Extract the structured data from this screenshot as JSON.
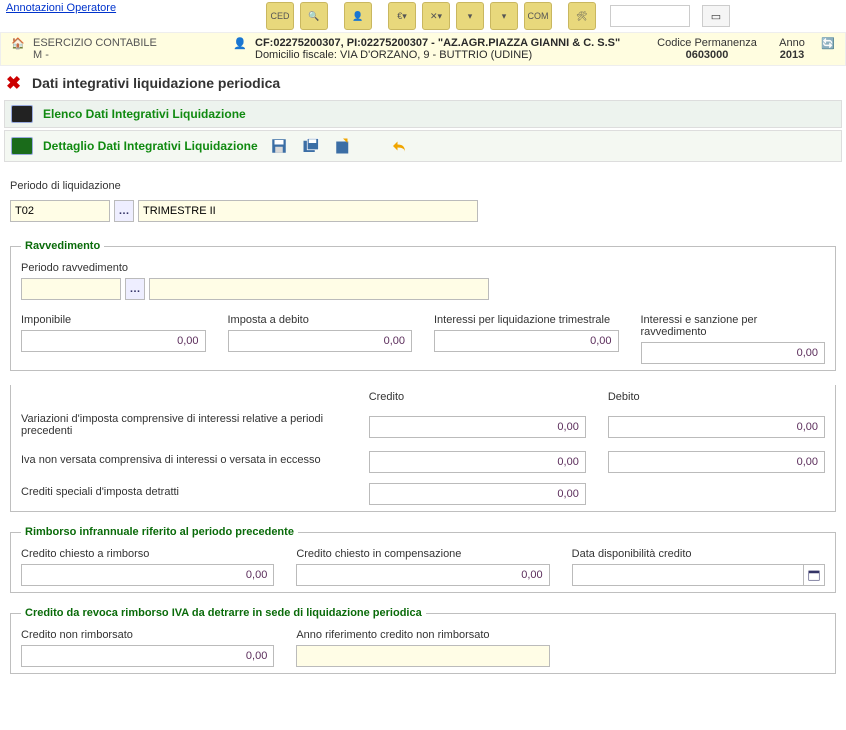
{
  "top": {
    "annotazioni": "Annotazioni Operatore",
    "toolbarIcons": [
      "CED",
      "doc",
      "user",
      "filter1",
      "filter2",
      "filter3",
      "filter4",
      "COM",
      "",
      "build"
    ]
  },
  "header": {
    "esercizio_lbl": "ESERCIZIO CONTABILE",
    "esercizio_val": "M -",
    "cf": "CF:02275200307, PI:02275200307 - \"AZ.AGR.PIAZZA GIANNI & C. S.S\"",
    "domicilio": "Domicilio fiscale: VIA D'ORZANO, 9 - BUTTRIO (UDINE)",
    "codperm_lbl": "Codice Permanenza",
    "codperm_val": "0603000",
    "anno_lbl": "Anno",
    "anno_val": "2013"
  },
  "title": "Dati integrativi liquidazione periodica",
  "tabs": {
    "elenco": "Elenco Dati Integrativi Liquidazione",
    "dettaglio": "Dettaglio Dati Integrativi Liquidazione"
  },
  "periodo": {
    "lbl": "Periodo di liquidazione",
    "code": "T02",
    "desc": "TRIMESTRE II"
  },
  "ravv": {
    "legend": "Ravvedimento",
    "per_lbl": "Periodo ravvedimento",
    "per_code": "",
    "per_desc": "",
    "imponibile_lbl": "Imponibile",
    "imposta_lbl": "Imposta a debito",
    "interessi_lbl": "Interessi per liquidazione trimestrale",
    "sanzione_lbl": "Interessi e sanzione per ravvedimento",
    "imponibile": "0,00",
    "imposta": "0,00",
    "interessi": "0,00",
    "sanzione": "0,00"
  },
  "var": {
    "credito_hdr": "Credito",
    "debito_hdr": "Debito",
    "row1_lbl": "Variazioni d'imposta comprensive di interessi relative a periodi precedenti",
    "row1_c": "0,00",
    "row1_d": "0,00",
    "row2_lbl": "Iva non versata comprensiva di interessi o versata in eccesso",
    "row2_c": "0,00",
    "row2_d": "0,00",
    "row3_lbl": "Crediti speciali d'imposta detratti",
    "row3_c": "0,00"
  },
  "rimb": {
    "legend": "Rimborso infrannuale riferito al periodo precedente",
    "c1_lbl": "Credito chiesto a rimborso",
    "c1": "0,00",
    "c2_lbl": "Credito chiesto in compensazione",
    "c2": "0,00",
    "c3_lbl": "Data disponibilità credito",
    "c3": ""
  },
  "revoca": {
    "legend": "Credito da revoca rimborso IVA da detrarre in sede di liquidazione periodica",
    "c1_lbl": "Credito non rimborsato",
    "c1": "0,00",
    "c2_lbl": "Anno riferimento credito non rimborsato",
    "c2": ""
  }
}
